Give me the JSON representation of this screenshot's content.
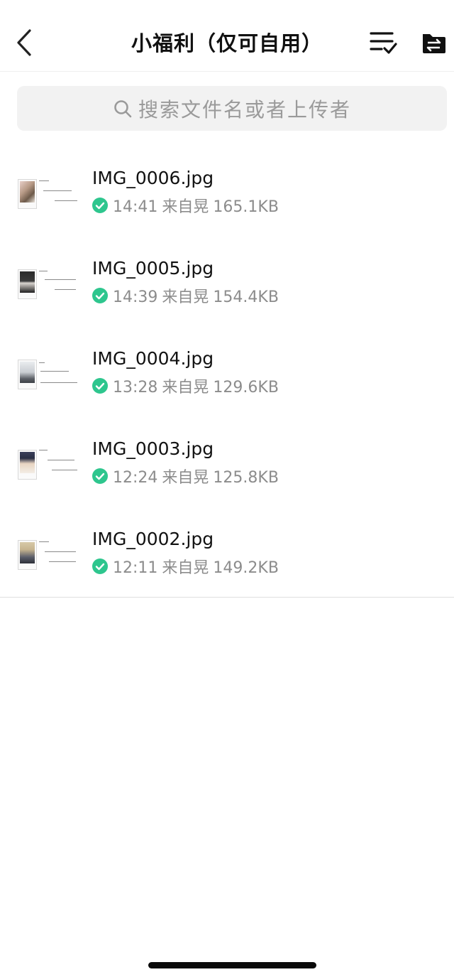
{
  "header": {
    "title": "小福利（仅可自用）",
    "back_icon": "chevron-left-icon",
    "sort_icon": "sort-check-icon",
    "folder_icon": "folder-transfer-icon"
  },
  "search": {
    "placeholder": "搜索文件名或者上传者",
    "icon": "search-icon"
  },
  "files": [
    {
      "name": "IMG_0006.jpg",
      "time": "14:41",
      "source": "来自晃",
      "size": "165.1KB",
      "status": "uploaded",
      "status_color": "#2ec68e"
    },
    {
      "name": "IMG_0005.jpg",
      "time": "14:39",
      "source": "来自晃",
      "size": "154.4KB",
      "status": "uploaded",
      "status_color": "#2ec68e"
    },
    {
      "name": "IMG_0004.jpg",
      "time": "13:28",
      "source": "来自晃",
      "size": "129.6KB",
      "status": "uploaded",
      "status_color": "#2ec68e"
    },
    {
      "name": "IMG_0003.jpg",
      "time": "12:24",
      "source": "来自晃",
      "size": "125.8KB",
      "status": "uploaded",
      "status_color": "#2ec68e"
    },
    {
      "name": "IMG_0002.jpg",
      "time": "12:11",
      "source": "来自晃",
      "size": "149.2KB",
      "status": "uploaded",
      "status_color": "#2ec68e"
    }
  ],
  "colors": {
    "accent_green": "#2ec68e",
    "search_bg": "#f2f2f2",
    "meta_gray": "#8c8c8c"
  }
}
